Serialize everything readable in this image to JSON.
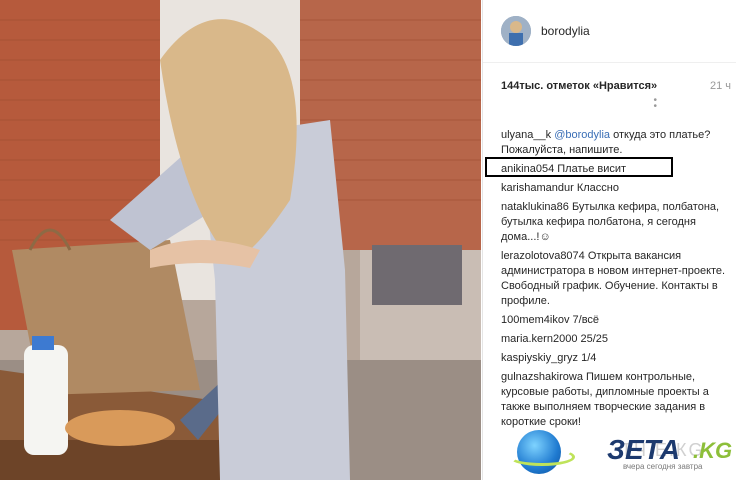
{
  "header": {
    "username": "borodylia"
  },
  "post": {
    "likes": "144тыс. отметок «Нравится»",
    "time": "21 ч",
    "more_dots": "•\n•"
  },
  "comments": [
    {
      "user": "ulyana__k",
      "mention": "@borodylia",
      "text": " откуда это платье? Пожалуйста, напишите."
    },
    {
      "user": "anikina054",
      "mention": "",
      "text": " Платье висит"
    },
    {
      "user": "karishamandur",
      "mention": "",
      "text": " Классно"
    },
    {
      "user": "nataklukina86",
      "mention": "",
      "text": " Бутылка кефира, полбатона, бутылка кефира полбатона, я сегодня дома...!☺"
    },
    {
      "user": "lerazolotova8074",
      "mention": "",
      "text": " Открыта вакансия администратора в новом интернет-проекте. Свободный график. Обучение. Контакты в профиле."
    },
    {
      "user": "100mem4ikov",
      "mention": "",
      "text": " 7/всё"
    },
    {
      "user": "maria.kern2000",
      "mention": "",
      "text": " 25/25"
    },
    {
      "user": "kaspiyskiy_gryz",
      "mention": "",
      "text": " 1/4"
    },
    {
      "user": "gulnazshakirowa",
      "mention": "",
      "text": " Пишем контрольные, курсовые работы, дипломные проекты а также выполняем творческие задания в короткие сроки!"
    }
  ],
  "watermark": {
    "brand": "ЗЕТА",
    "suffix": ".KG",
    "ghost": "ТЧ.Е.КG",
    "tagline": "вчера сегодня завтра"
  },
  "colors": {
    "mention": "#3b6fb6",
    "highlight_border": "#000000",
    "brand_blue": "#1d3a6e",
    "brand_green": "#8dbf3a"
  }
}
